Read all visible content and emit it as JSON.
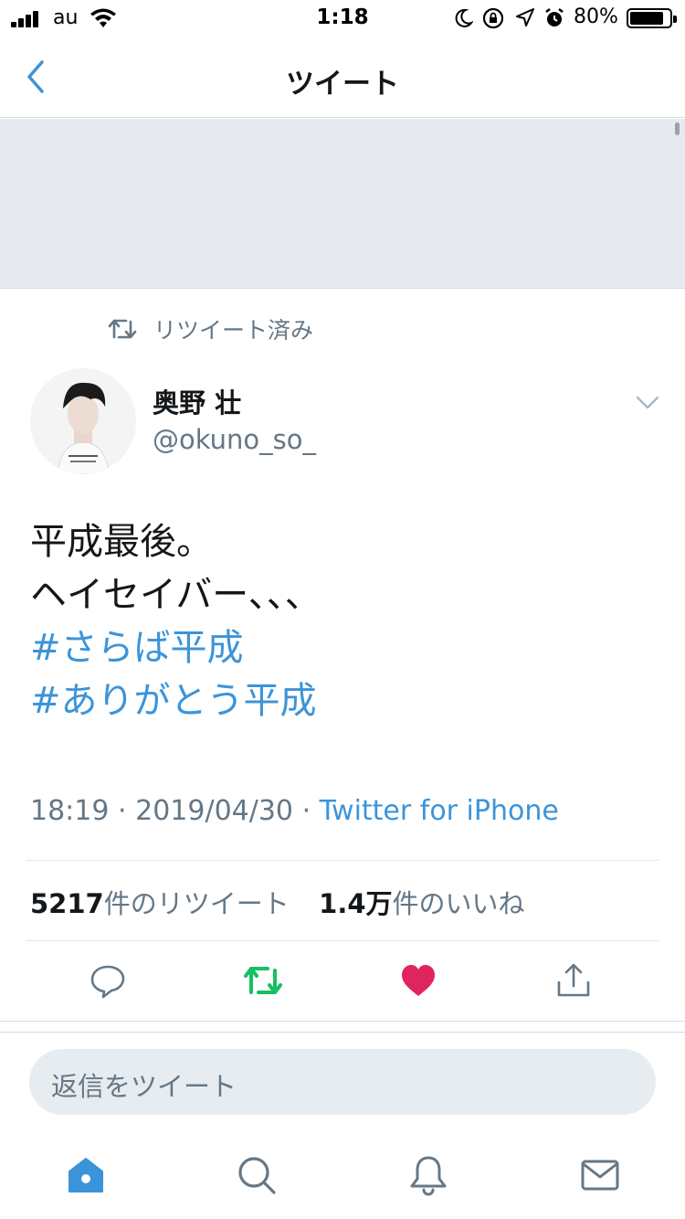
{
  "status_bar": {
    "carrier": "au",
    "time": "1:18",
    "battery": "80%"
  },
  "nav": {
    "title": "ツイート",
    "back_icon": "chevron-left-icon"
  },
  "retweet_context": {
    "label": "リツイート済み",
    "icon": "retweet-icon"
  },
  "tweet": {
    "author": {
      "display_name": "奥野 壮",
      "handle": "@okuno_so_"
    },
    "lines": [
      "平成最後。",
      "ヘイセイバー、、、"
    ],
    "hashtags": [
      "#さらば平成",
      "#ありがとう平成"
    ],
    "time": "18:19",
    "date": "2019/04/30",
    "separator": "·",
    "source": "Twitter for iPhone",
    "retweet_count": "5217",
    "retweet_label": "件のリツイート",
    "like_count": "1.4万",
    "like_label": "件のいいね",
    "liked": true,
    "retweeted": true
  },
  "reply": {
    "placeholder": "返信をツイート"
  },
  "tab_bar": {
    "items": [
      "home-icon",
      "search-icon",
      "notifications-icon",
      "messages-icon"
    ]
  },
  "colors": {
    "accent": "#3b94d9",
    "retweet_green": "#17bf63",
    "like_red": "#e0245e",
    "secondary_text": "#657786",
    "banner_bg": "#e6e9ee"
  }
}
